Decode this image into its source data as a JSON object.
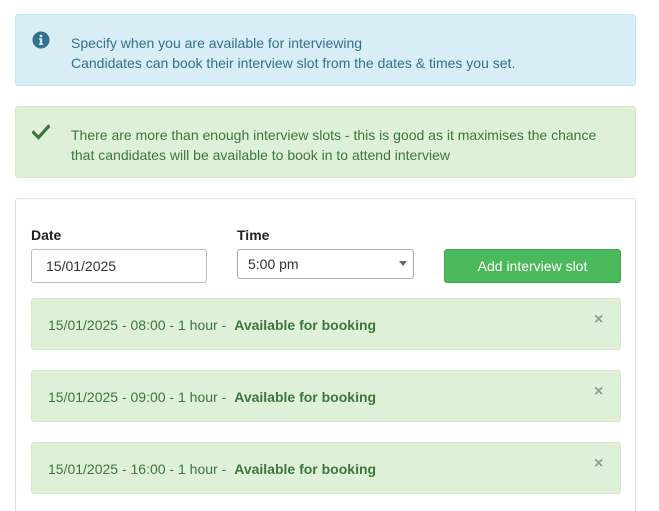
{
  "info_alert": {
    "line1": "Specify when you are available for interviewing",
    "line2": "Candidates can book their interview slot from the dates & times you set."
  },
  "success_alert": {
    "line1": "There are more than enough interview slots - this is good as it maximises the chance",
    "line2": "that candidates will be available to book in to attend interview"
  },
  "form": {
    "date_label": "Date",
    "date_value": "15/01/2025",
    "time_label": "Time",
    "time_value": "5:00 pm",
    "add_button": "Add interview slot"
  },
  "slots": [
    {
      "text": "15/01/2025 - 08:00 - 1 hour -",
      "status": "Available for booking",
      "close": "×"
    },
    {
      "text": "15/01/2025 - 09:00 - 1 hour -",
      "status": "Available for booking",
      "close": "×"
    },
    {
      "text": "15/01/2025 - 16:00 - 1 hour -",
      "status": "Available for booking",
      "close": "×"
    }
  ],
  "colors": {
    "info_bg": "#d9edf7",
    "info_text": "#31708f",
    "success_bg": "#dff0d8",
    "success_text": "#3c763d",
    "button_bg": "#4cb85c"
  },
  "icons": {
    "info": "info-circle-icon",
    "success": "checkmark-icon",
    "close": "close-icon"
  }
}
